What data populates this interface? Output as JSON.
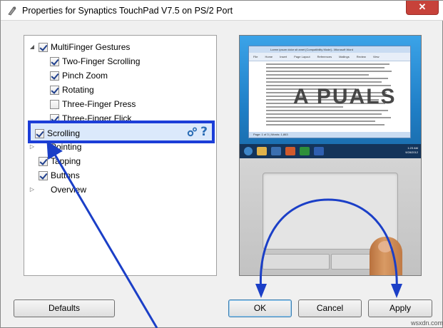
{
  "window": {
    "title": "Properties for Synaptics TouchPad V7.5 on PS/2 Port",
    "close_label": "✕"
  },
  "tree": {
    "items": [
      {
        "label": "MultiFinger Gestures",
        "checked": true,
        "expander": "◢"
      },
      {
        "label": "Two-Finger Scrolling",
        "checked": true
      },
      {
        "label": "Pinch Zoom",
        "checked": true
      },
      {
        "label": "Rotating",
        "checked": true
      },
      {
        "label": "Three-Finger Press",
        "checked": false
      },
      {
        "label": "Three-Finger Flick",
        "checked": true
      },
      {
        "label": "Scrolling",
        "checked": true,
        "selected": true
      },
      {
        "label": "Pointing",
        "expander": "▷"
      },
      {
        "label": "Tapping",
        "checked": true
      },
      {
        "label": "Buttons",
        "checked": true
      },
      {
        "label": "Overview",
        "expander": "▷"
      }
    ]
  },
  "preview": {
    "doc_title": "Lorem ipsum dolor sit amet [Compatibility Mode] - Microsoft Word",
    "ribbon_tabs": [
      "File",
      "Home",
      "Insert",
      "Page Layout",
      "References",
      "Mailings",
      "Review",
      "View"
    ],
    "status": "Page: 1 of 3 | Words: 1,863",
    "tray_time": "1:23 AM",
    "tray_date": "9/28/2012"
  },
  "brand_watermark": "A PUALS",
  "buttons": {
    "defaults": "Defaults",
    "ok": "OK",
    "cancel": "Cancel",
    "apply": "Apply"
  },
  "site_watermark": "wsxdn.com",
  "colors": {
    "highlight_border": "#1c3ed8",
    "arrow": "#1b3fc7",
    "close_button": "#c7423a"
  }
}
